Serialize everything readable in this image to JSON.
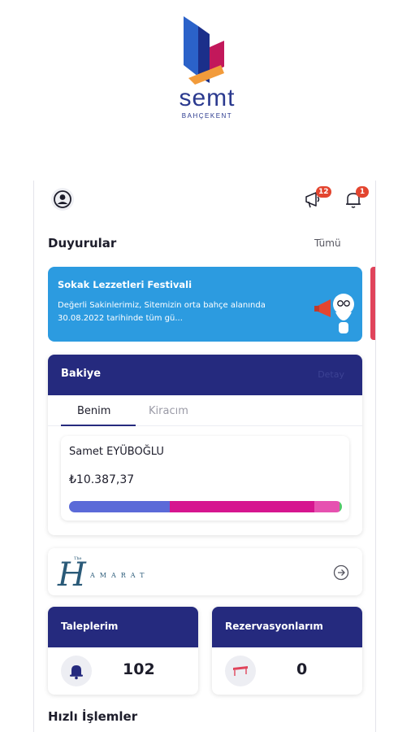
{
  "brand": {
    "wordmark": "semt",
    "subtitle": "BAHÇEKENT",
    "colors": [
      "#2b3a8f",
      "#e3452f",
      "#c2185b",
      "#f29b3b"
    ]
  },
  "header": {
    "announcements_badge": "12",
    "notifications_badge": "1",
    "icons": [
      "user-icon",
      "megaphone-icon",
      "bell-icon"
    ]
  },
  "announcements": {
    "title": "Duyurular",
    "see_all": "Tümü",
    "items": [
      {
        "title": "Sokak Lezzetleri Festivali",
        "body": "Değerli Sakinlerimiz, Sitemizin orta bahçe alanında 30.08.2022 tarihinde tüm gü..."
      }
    ]
  },
  "balance": {
    "title": "Bakiye",
    "detail": "Detay",
    "tabs": [
      "Benim",
      "Kiracım"
    ],
    "active_tab": 0,
    "owner": "Samet EYÜBOĞLU",
    "amount": "₺10.387,37",
    "segments": [
      {
        "share": 0.37,
        "color": "#5b6ad8"
      },
      {
        "share": 0.53,
        "color": "#d6158f"
      },
      {
        "share": 0.09,
        "color": "#e651b0"
      },
      {
        "share": 0.01,
        "color": "#52c86a"
      }
    ]
  },
  "partner": {
    "logo_letter": "H",
    "logo_word": "AMARAT",
    "logo_small": "The"
  },
  "requests": {
    "title": "Taleplerim",
    "count": "102"
  },
  "reservations": {
    "title": "Rezervasyonlarım",
    "count": "0"
  },
  "quick_actions": {
    "title": "Hızlı İşlemler"
  },
  "colors": {
    "primary": "#252a7e",
    "accent": "#2c9be0",
    "badge": "#e3452f"
  }
}
